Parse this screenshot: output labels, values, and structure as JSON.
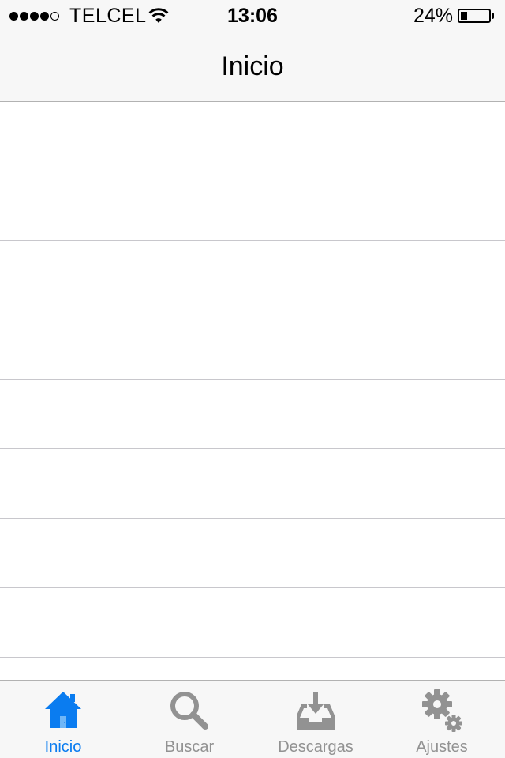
{
  "status_bar": {
    "signal_bars_filled": 4,
    "signal_bars_total": 5,
    "carrier": "TELCEL",
    "time": "13:06",
    "battery_percent_label": "24%",
    "battery_level": 0.24,
    "wifi_icon": "wifi-icon",
    "battery_icon": "battery-icon"
  },
  "nav_bar": {
    "title": "Inicio"
  },
  "table": {
    "rows": [
      "",
      "",
      "",
      "",
      "",
      "",
      "",
      "",
      ""
    ]
  },
  "tab_bar": {
    "active_tab": "Inicio",
    "active_color": "#0a7cf0",
    "inactive_color": "#929292",
    "tabs": [
      {
        "label": "Inicio",
        "icon": "home-icon"
      },
      {
        "label": "Buscar",
        "icon": "search-icon"
      },
      {
        "label": "Descargas",
        "icon": "download-tray-icon"
      },
      {
        "label": "Ajustes",
        "icon": "gears-icon"
      }
    ]
  }
}
